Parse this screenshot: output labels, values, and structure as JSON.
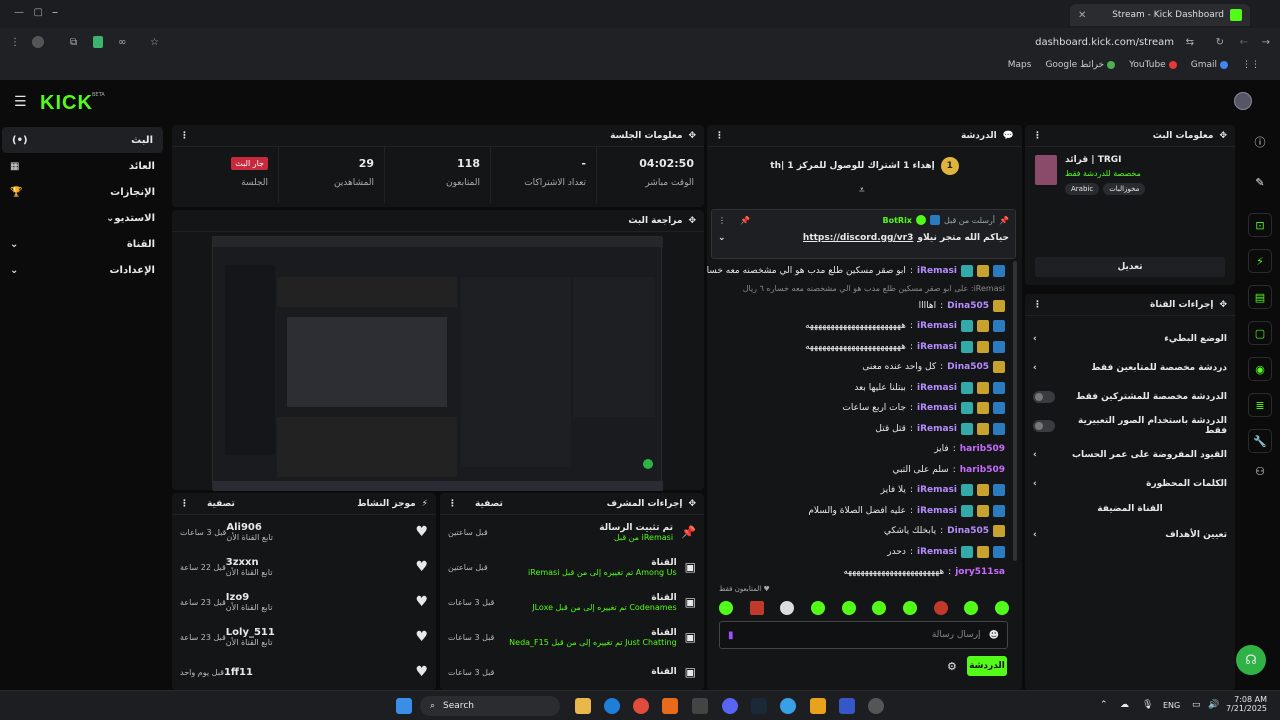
{
  "browser": {
    "tab_title": "Stream - Kick Dashboard",
    "url": "dashboard.kick.com/stream",
    "bookmarks": [
      "Maps",
      "Google خرائط",
      "YouTube",
      "Gmail"
    ]
  },
  "app": {
    "logo": "KICK",
    "beta": "BETA"
  },
  "sidebar": {
    "items": [
      {
        "label": "البث",
        "active": true
      },
      {
        "label": "العائد"
      },
      {
        "label": "الإنجازات"
      },
      {
        "label": "الاستديو"
      },
      {
        "label": "القناة"
      },
      {
        "label": "الإعدادات"
      }
    ]
  },
  "session": {
    "title": "معلومات الجلسة",
    "badge": "جار البث",
    "stats": [
      {
        "label": "الجلسة",
        "value": ""
      },
      {
        "label": "المشاهدين",
        "value": "29"
      },
      {
        "label": "المتابعون",
        "value": "118"
      },
      {
        "label": "تعداد الاشتراكات",
        "value": "-"
      },
      {
        "label": "الوقت مباشر",
        "value": "04:02:50"
      }
    ]
  },
  "preview": {
    "title": "مراجعة البث"
  },
  "activity": {
    "title": "موجز النشاط",
    "filter": "تصفية",
    "items": [
      {
        "user": "Ali906",
        "text": "تابع القناة الأن",
        "time": "قبل 3 ساعات"
      },
      {
        "user": "3zxxn",
        "text": "تابع القناة الأن",
        "time": "قبل 22 ساعة"
      },
      {
        "user": "Izo9",
        "text": "تابع القناة الأن",
        "time": "قبل 23 ساعة"
      },
      {
        "user": "Loly_511",
        "text": "تابع القناة الأن",
        "time": "قبل 23 ساعة"
      },
      {
        "user": "1ff11",
        "text": "",
        "time": "قبل يوم واحد"
      }
    ]
  },
  "moderator": {
    "title": "إجراءات المشرف",
    "filter": "تصفية",
    "items": [
      {
        "title": "تم تثبيت الرسالة",
        "detail": "iRemasi من قبل",
        "time": "قبل ساعتين"
      },
      {
        "title": "القناة",
        "detail": "Among Us تم تغييره إلى من قبل iRemasi",
        "time": "قبل ساعتين"
      },
      {
        "title": "القناة",
        "detail": "Codenames تم تغييره إلى من قبل JLoxe",
        "time": "قبل 3 ساعات"
      },
      {
        "title": "القناة",
        "detail": "Just Chatting تم تغييره إلى من قبل Neda_F15",
        "time": "قبل 3 ساعات"
      },
      {
        "title": "القناة",
        "detail": "",
        "time": "قبل 3 ساعات"
      }
    ]
  },
  "chat": {
    "title": "الدردشة",
    "goal": "إهداء 1 اشتراك للوصول للمركز 1 |th",
    "goal_num": "1",
    "pinned_user": "BotRix",
    "pinned_meta": "أرسلت من قبل",
    "pinned_text": "حياكم الله متجر نيلاو",
    "pinned_link": "https://discord.gg/vr3",
    "followers_only": "المتابعون فقط",
    "input_placeholder": "إرسال رسالة",
    "send": "الدردشة",
    "messages": [
      {
        "user": "iRemasi",
        "text": "ابو صقر مسكين طلع مدب هو الي مشخصنه معه خساره ٦ ريال",
        "color": "#b78cff"
      },
      {
        "user": "",
        "text": "iRemasi: على ابو صقر مسكين طلع مدب هو الي مشخصنه معه خساره ٦ ريال",
        "color": "#888"
      },
      {
        "user": "Dina505",
        "text": "اهاااا",
        "color": "#b78cff"
      },
      {
        "user": "iRemasi",
        "text": "هههههههههههههههههههههههه",
        "color": "#b78cff"
      },
      {
        "user": "iRemasi",
        "text": "هههههههههههههههههههههههه",
        "color": "#b78cff"
      },
      {
        "user": "Dina505",
        "text": "كل واحد عنده معنى",
        "color": "#b78cff"
      },
      {
        "user": "iRemasi",
        "text": "ببتلنا عليها بعد",
        "color": "#b78cff"
      },
      {
        "user": "iRemasi",
        "text": "جات اربع ساعات",
        "color": "#b78cff"
      },
      {
        "user": "iRemasi",
        "text": "قتل قتل",
        "color": "#b78cff"
      },
      {
        "user": "harib509",
        "text": "فايز",
        "color": "#c86bff"
      },
      {
        "user": "harib509",
        "text": "سلم على التبي",
        "color": "#c86bff"
      },
      {
        "user": "iRemasi",
        "text": "يلا فايز",
        "color": "#b78cff"
      },
      {
        "user": "iRemasi",
        "text": "عليه افضل الصلاة والسلام",
        "color": "#b78cff"
      },
      {
        "user": "Dina505",
        "text": "يابخلك ياشكي",
        "color": "#b78cff"
      },
      {
        "user": "iRemasi",
        "text": "دحدر",
        "color": "#b78cff"
      },
      {
        "user": "jory511sa",
        "text": "هههههههههههههههههههههههه",
        "color": "#c86bff"
      }
    ]
  },
  "stream_info": {
    "title": "معلومات البث",
    "stream_title": "TRGI | قرائد",
    "category": "مخصصة للدردشة فقط",
    "tags": [
      "Arabic",
      "مخوزالبات"
    ],
    "edit": "تعديل"
  },
  "channel_actions": {
    "title": "إجراءات القناة",
    "rows": [
      {
        "label": "الوضع البطيء",
        "type": "chevron"
      },
      {
        "label": "دردشة مخصصة للمتابعين فقط",
        "type": "chevron"
      },
      {
        "label": "الدردشة مخصصة للمشتركين فقط",
        "type": "toggle"
      },
      {
        "label": "الدردشة باستخدام الصور التعبيرية فقط",
        "type": "toggle"
      },
      {
        "label": "القيود المفروضة على عمر الحساب",
        "type": "chevron"
      },
      {
        "label": "الكلمات المحظورة",
        "type": "chevron"
      },
      {
        "label": "القناة المضيفة",
        "type": "none"
      },
      {
        "label": "تعيين الأهداف",
        "type": "chevron"
      }
    ]
  },
  "taskbar": {
    "search": "Search",
    "lang": "ENG",
    "time": "7:08 AM",
    "date": "7/21/2025"
  }
}
